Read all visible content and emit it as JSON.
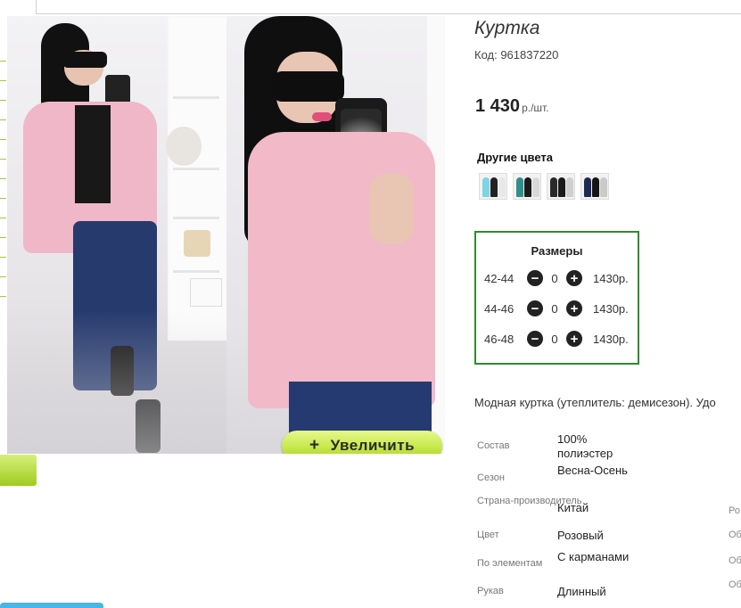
{
  "product": {
    "title": "Куртка",
    "code": "Код: 961837220",
    "price": "1 430",
    "price_unit": "р./шт."
  },
  "photo": {
    "zoom_label": "Увеличить",
    "zoom_icon": "plus-icon"
  },
  "colors": {
    "title": "Другие цвета",
    "swatches": [
      {
        "name": "variant-1",
        "tones": [
          "#7fd3e6",
          "#222222",
          "#e8e8e8"
        ]
      },
      {
        "name": "variant-2",
        "tones": [
          "#2f8f8a",
          "#1b1b1b",
          "#d8d8d8"
        ]
      },
      {
        "name": "variant-3",
        "tones": [
          "#2a2a2a",
          "#1a1a1a",
          "#cfcfcf"
        ]
      },
      {
        "name": "variant-4",
        "tones": [
          "#1d2a55",
          "#151515",
          "#cacaca"
        ]
      }
    ]
  },
  "sizes": {
    "title": "Размеры",
    "rows": [
      {
        "size": "42-44",
        "qty": "0",
        "price": "1430р."
      },
      {
        "size": "44-46",
        "qty": "0",
        "price": "1430р."
      },
      {
        "size": "46-48",
        "qty": "0",
        "price": "1430р."
      }
    ]
  },
  "description": "Модная куртка (утеплитель: демисезон). Удо",
  "properties": [
    {
      "key": "Состав",
      "value": "100% полиэстер"
    },
    {
      "key": "Сезон",
      "value": "Весна-Осень"
    },
    {
      "key": "Страна-производитель",
      "value": "Китай"
    },
    {
      "key": "Цвет",
      "value": "Розовый"
    },
    {
      "key": "По элементам",
      "value": "С карманами"
    },
    {
      "key": "Рукав",
      "value": "Длинный"
    }
  ],
  "right_cut": [
    "Ро",
    "Об",
    "Об",
    "Об"
  ],
  "colors_palette": {
    "accent_green": "#2e8b2e",
    "zoom_button": "#c6e84a"
  }
}
